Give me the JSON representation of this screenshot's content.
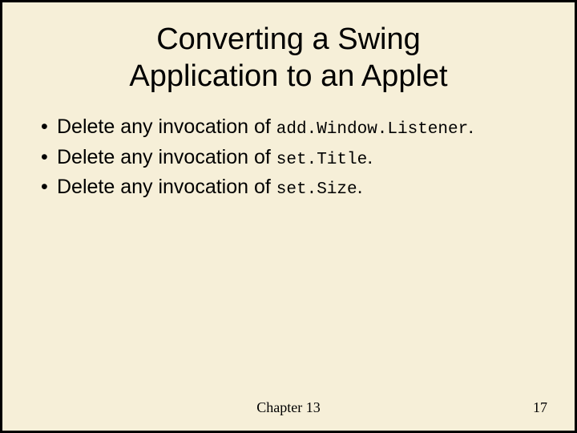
{
  "title_line1": "Converting a Swing",
  "title_line2": "Application to an Applet",
  "bullets": [
    {
      "prefix": "Delete any invocation of ",
      "code": "add.Window.Listener",
      "suffix": "."
    },
    {
      "prefix": "Delete any invocation of ",
      "code": "set.Title",
      "suffix": "."
    },
    {
      "prefix": "Delete any invocation of ",
      "code": "set.Size",
      "suffix": "."
    }
  ],
  "footer": {
    "chapter": "Chapter 13",
    "page": "17"
  }
}
